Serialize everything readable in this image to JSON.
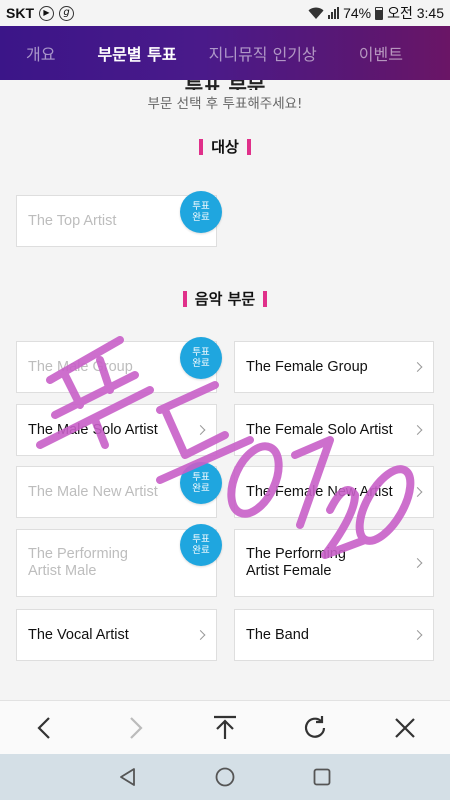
{
  "status_bar": {
    "carrier": "SKT",
    "battery": "74%",
    "time": "오전 3:45",
    "icons": [
      "play-circle-icon",
      "g-circle-icon",
      "wifi-icon",
      "signal-icon",
      "battery-icon"
    ]
  },
  "tabs": [
    {
      "label": "개요",
      "active": false
    },
    {
      "label": "부문별 투표",
      "active": true
    },
    {
      "label": "지니뮤직 인기상",
      "active": false
    },
    {
      "label": "이벤트",
      "active": false
    }
  ],
  "page": {
    "heading_partial": "투표 부문",
    "subtitle": "부문 선택 후 투표해주세요!"
  },
  "grand_prize": {
    "title": "대상",
    "items": [
      {
        "label": "The Top Artist",
        "voted": true
      }
    ]
  },
  "music_section": {
    "title": "음악 부문",
    "items": [
      {
        "label": "The Male Group",
        "voted": true
      },
      {
        "label": "The Female Group",
        "voted": false
      },
      {
        "label": "The Male Solo Artist",
        "voted": false
      },
      {
        "label": "The Female Solo Artist",
        "voted": false
      },
      {
        "label": "The Male New Artist",
        "voted": true
      },
      {
        "label": "The Female New Artist",
        "voted": false
      },
      {
        "label": "The Performing Artist Male",
        "voted": true
      },
      {
        "label": "The Performing Artist Female",
        "voted": false
      },
      {
        "label": "The Vocal Artist",
        "voted": false
      },
      {
        "label": "The Band",
        "voted": false
      }
    ]
  },
  "badge": {
    "line1": "투표",
    "line2": "완료"
  },
  "watermark": {
    "text": "프드0720",
    "color": "#c85dc8"
  },
  "browser_toolbar": [
    "back-icon",
    "forward-icon",
    "scroll-top-icon",
    "refresh-icon",
    "close-icon"
  ],
  "system_nav": [
    "back-triangle-icon",
    "home-circle-icon",
    "recents-square-icon"
  ],
  "colors": {
    "tab_gradient_start": "#3b1588",
    "tab_gradient_end": "#6a1566",
    "accent_bar": "#e0308a",
    "badge": "#1fa6df"
  }
}
